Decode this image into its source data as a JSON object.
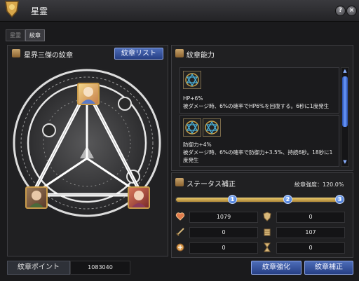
{
  "window": {
    "title": "星霊"
  },
  "tabs": [
    {
      "label": "星霊",
      "active": false
    },
    {
      "label": "紋章",
      "active": true
    }
  ],
  "left_panel": {
    "title": "星界三傑の紋章",
    "list_button": "紋章リスト"
  },
  "ability_panel": {
    "title": "紋章能力",
    "abilities": [
      {
        "line1": "HP+6%",
        "line2": "被ダメージ時、6%の確率でHP6%を回復する。6秒に1度発生"
      },
      {
        "line1": "防御力+4%",
        "line2": "被ダメージ時、6%の確率で防御力+3.5%、持続6秒。18秒に1度発生"
      }
    ]
  },
  "status_panel": {
    "title": "ステータス補正",
    "strength_label": "紋章強度：120.0%",
    "slider_levels": [
      "1",
      "2",
      "3"
    ],
    "stats": [
      {
        "left_icon": "heart-icon",
        "left_value": "1079",
        "right_icon": "shield-icon",
        "right_value": "0"
      },
      {
        "left_icon": "sword-icon",
        "left_value": "0",
        "right_icon": "armor-icon",
        "right_value": "107"
      },
      {
        "left_icon": "medal-icon",
        "left_value": "0",
        "right_icon": "hourglass-icon",
        "right_value": "0"
      }
    ]
  },
  "footer": {
    "points_label": "紋章ポイント",
    "points_value": "1083040",
    "enhance_button": "紋章強化",
    "correct_button": "紋章補正"
  },
  "colors": {
    "accent_blue": "#3a5aa8",
    "gold": "#c89a4a",
    "panel_bg": "#202022"
  }
}
